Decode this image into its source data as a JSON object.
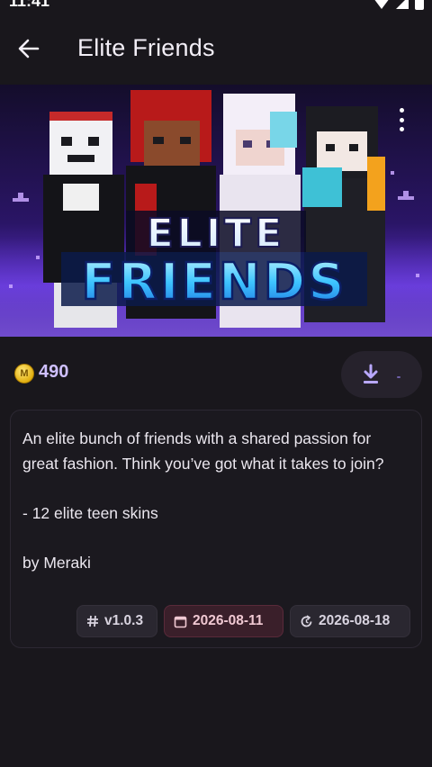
{
  "status_bar": {
    "time": "11:41",
    "icons": [
      "wifi-icon",
      "signal-icon",
      "battery-icon"
    ]
  },
  "app_bar": {
    "title": "Elite Friends",
    "back_icon": "arrow-left-icon"
  },
  "banner": {
    "logo_line1": "ELITE",
    "logo_line2": "FRIENDS",
    "menu_icon": "more-vertical-icon"
  },
  "product": {
    "price": "490",
    "coin_icon": "minecoin-icon",
    "download_icon": "download-icon"
  },
  "description": {
    "lines": [
      "An elite bunch of friends with a shared passion for great fashion. Think you’ve got what it takes to join?",
      "",
      "- 12 elite teen skins",
      "",
      "by Meraki"
    ]
  },
  "tags": {
    "version": "v1.0.3",
    "created": "2026-08-11",
    "updated": "2026-08-18"
  },
  "colors": {
    "background": "#19171c",
    "price": "#cfc0ff",
    "accent": "#b9a8ff",
    "created_tag_bg": "#3a1f2a"
  }
}
